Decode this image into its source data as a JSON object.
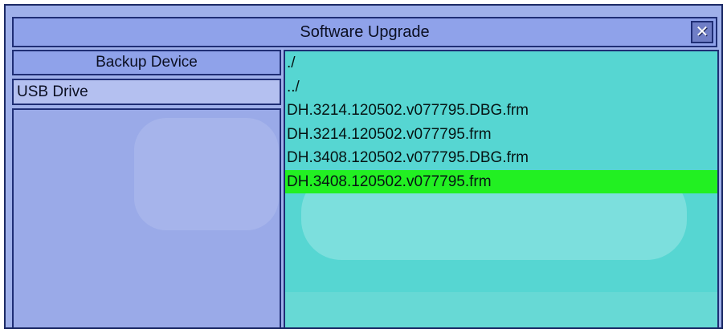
{
  "dialog": {
    "title": "Software Upgrade",
    "close_icon": "close-icon"
  },
  "left_panel": {
    "header": "Backup Device",
    "device": "USB Drive"
  },
  "files": [
    {
      "name": "./",
      "selected": false
    },
    {
      "name": "../",
      "selected": false
    },
    {
      "name": "DH.3214.120502.v077795.DBG.frm",
      "selected": false
    },
    {
      "name": "DH.3214.120502.v077795.frm",
      "selected": false
    },
    {
      "name": "DH.3408.120502.v077795.DBG.frm",
      "selected": false
    },
    {
      "name": "DH.3408.120502.v077795.frm",
      "selected": true
    }
  ],
  "colors": {
    "selection": "#22f022",
    "file_panel_bg": "#56d6d2",
    "dialog_bg": "#9fb0ea"
  }
}
